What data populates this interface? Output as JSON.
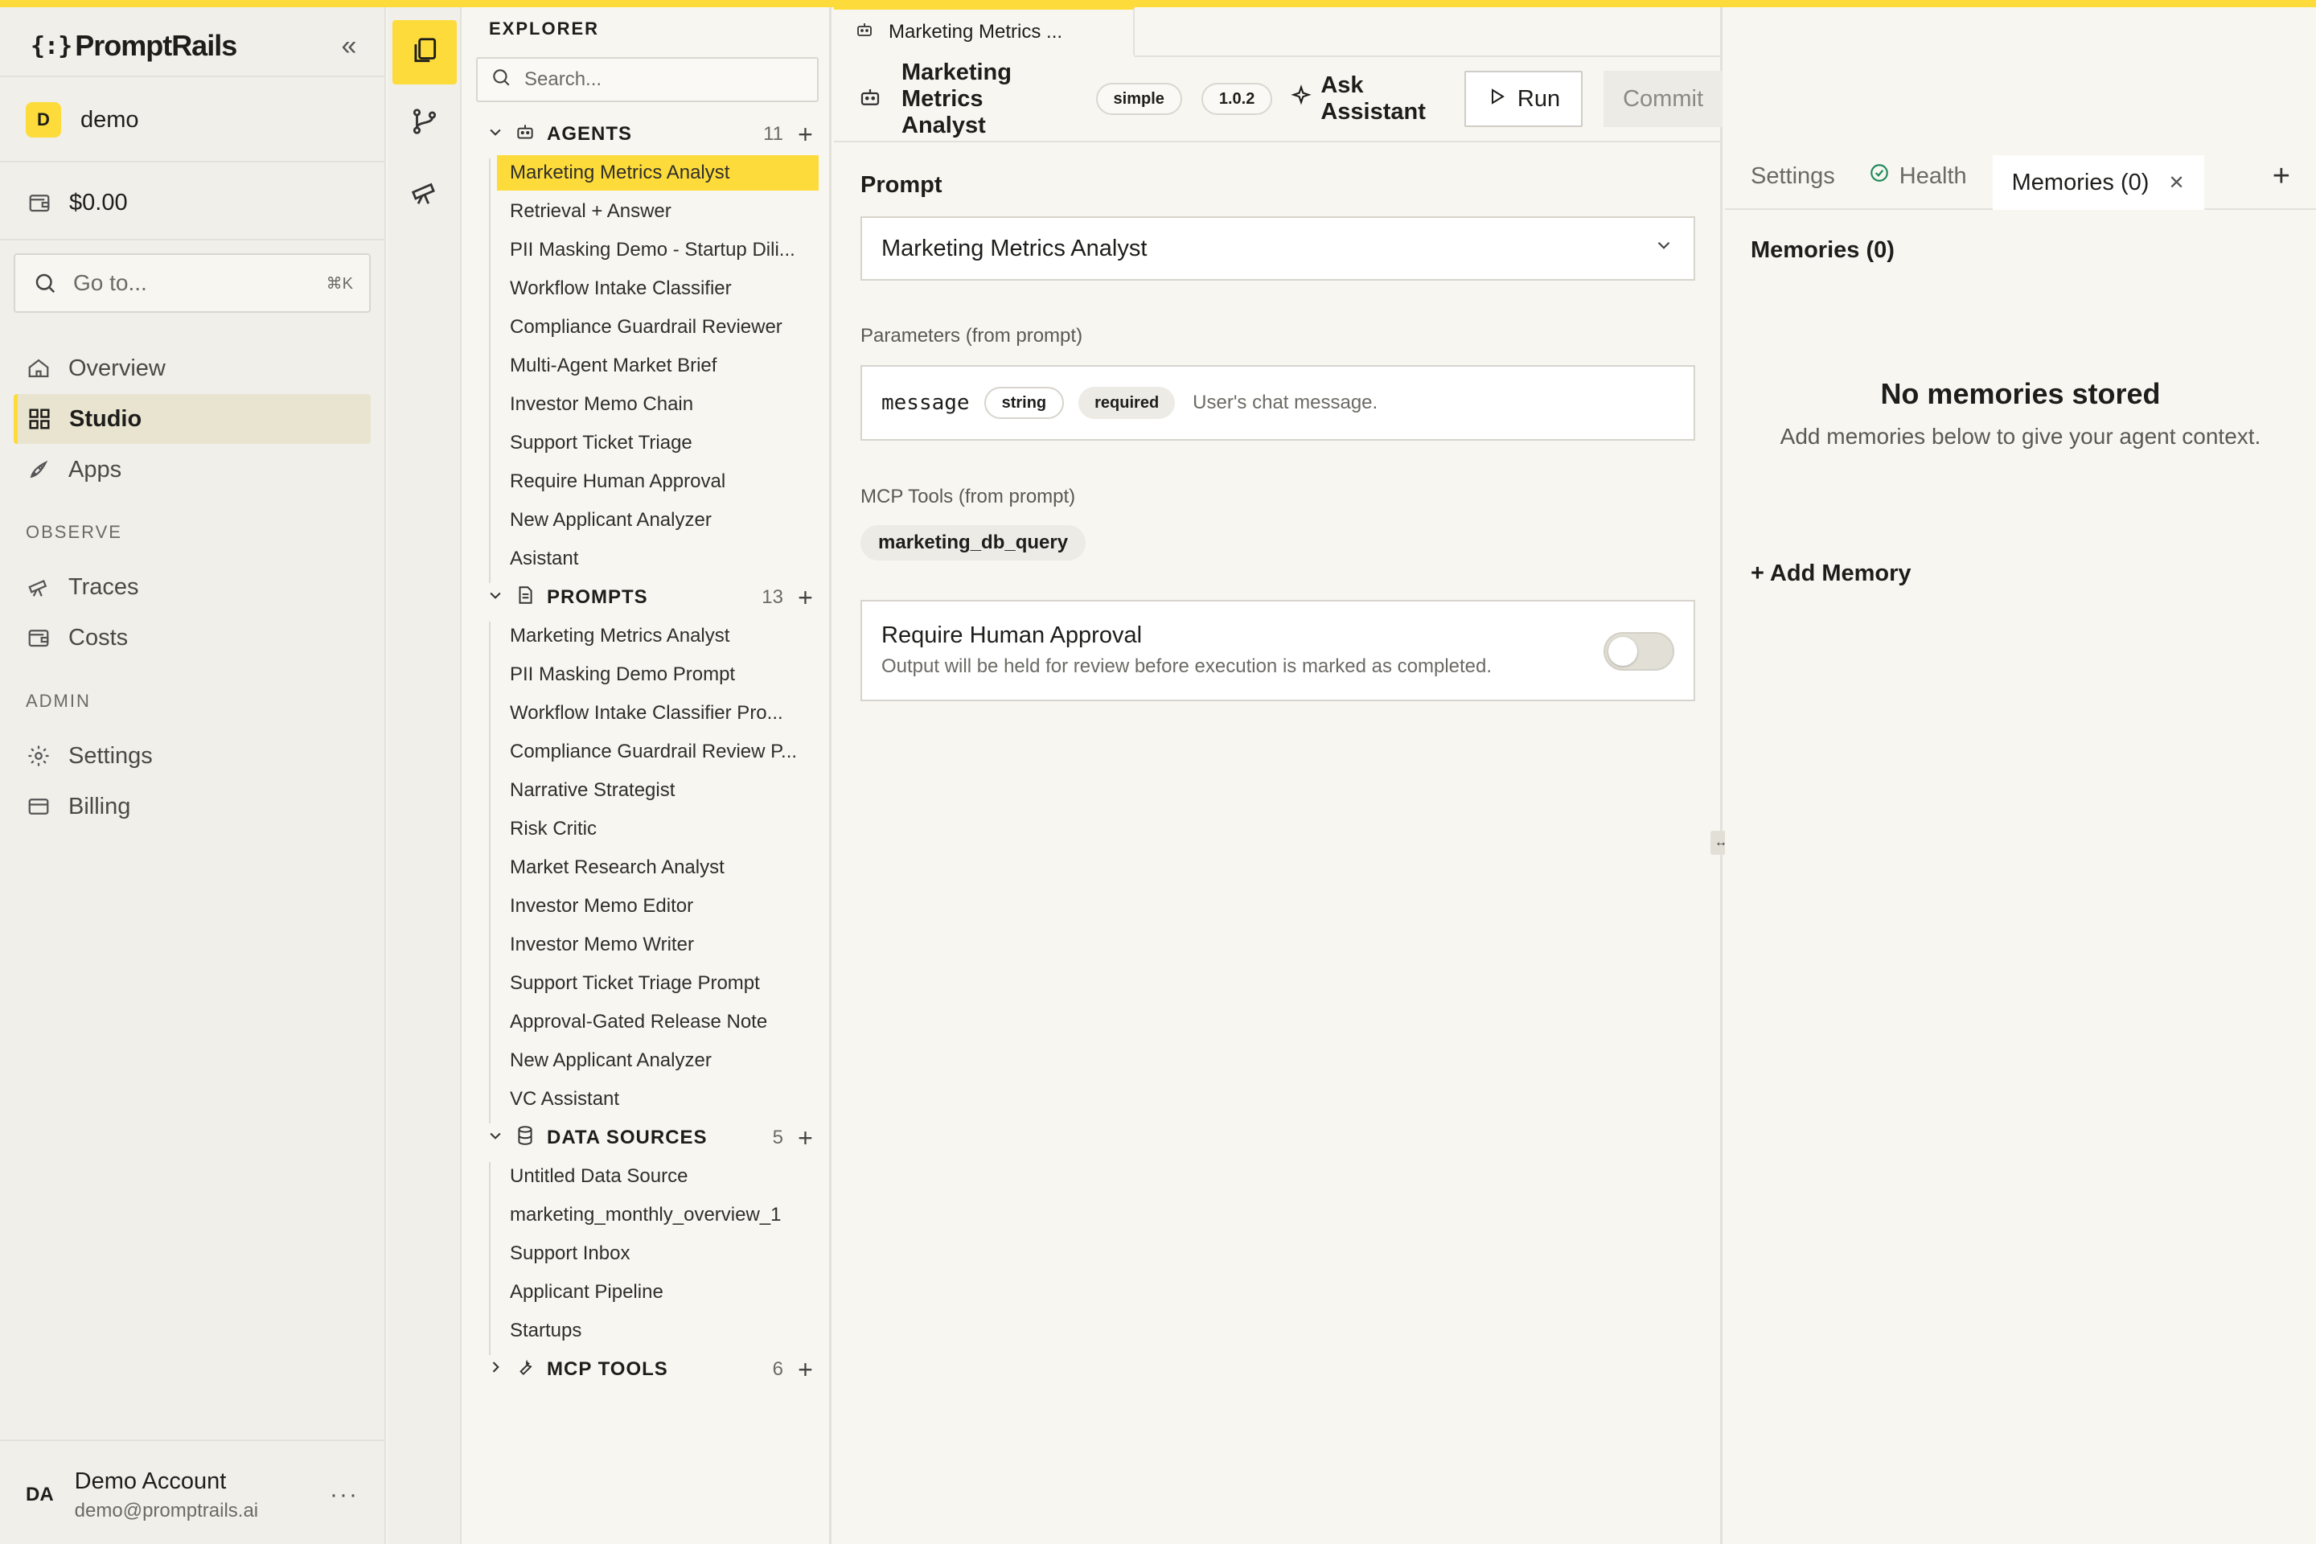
{
  "brand": {
    "name": "PromptRails",
    "accent": "#fddb3a"
  },
  "sidebar": {
    "collapse_label": "«",
    "workspace": {
      "initial": "D",
      "name": "demo"
    },
    "balance": "$0.00",
    "goto": {
      "placeholder": "Go to...",
      "shortcut": "⌘K"
    },
    "nav": [
      {
        "label": "Overview",
        "icon": "home-icon"
      },
      {
        "label": "Studio",
        "icon": "grid-icon",
        "active": true
      },
      {
        "label": "Apps",
        "icon": "rocket-icon"
      }
    ],
    "observe_label": "OBSERVE",
    "observe": [
      {
        "label": "Traces",
        "icon": "telescope-icon"
      },
      {
        "label": "Costs",
        "icon": "wallet-icon"
      }
    ],
    "admin_label": "ADMIN",
    "admin": [
      {
        "label": "Settings",
        "icon": "gear-icon"
      },
      {
        "label": "Billing",
        "icon": "card-icon"
      }
    ],
    "account": {
      "initials": "DA",
      "name": "Demo Account",
      "email": "demo@promptrails.ai",
      "more": "···"
    }
  },
  "explorer": {
    "title": "EXPLORER",
    "search_placeholder": "Search...",
    "agents": {
      "label": "AGENTS",
      "count": "11",
      "items": [
        "Marketing Metrics Analyst",
        "Retrieval + Answer",
        "PII Masking Demo - Startup Dili...",
        "Workflow Intake Classifier",
        "Compliance Guardrail Reviewer",
        "Multi-Agent Market Brief",
        "Investor Memo Chain",
        "Support Ticket Triage",
        "Require Human Approval",
        "New Applicant Analyzer",
        "Asistant"
      ]
    },
    "prompts": {
      "label": "PROMPTS",
      "count": "13",
      "items": [
        "Marketing Metrics Analyst",
        "PII Masking Demo Prompt",
        "Workflow Intake Classifier Pro...",
        "Compliance Guardrail Review P...",
        "Narrative Strategist",
        "Risk Critic",
        "Market Research Analyst",
        "Investor Memo Editor",
        "Investor Memo Writer",
        "Support Ticket Triage Prompt",
        "Approval-Gated Release Note",
        "New Applicant Analyzer",
        "VC Assistant"
      ]
    },
    "data_sources": {
      "label": "DATA SOURCES",
      "count": "5",
      "items": [
        "Untitled Data Source",
        "marketing_monthly_overview_1",
        "Support Inbox",
        "Applicant Pipeline",
        "Startups"
      ]
    },
    "mcp_tools": {
      "label": "MCP TOOLS",
      "count": "6"
    }
  },
  "editor": {
    "tab_label": "Marketing Metrics ...",
    "title": "Marketing Metrics Analyst",
    "type_badge": "simple",
    "version_badge": "1.0.2",
    "ask_label": "Ask Assistant",
    "run_label": "Run",
    "commit_label": "Commit",
    "prompt_label": "Prompt",
    "prompt_value": "Marketing Metrics Analyst",
    "params_label": "Parameters (from prompt)",
    "param": {
      "name": "message",
      "type": "string",
      "required": "required",
      "description": "User's chat message."
    },
    "tools_label": "MCP Tools (from prompt)",
    "tool": "marketing_db_query",
    "approval": {
      "title": "Require Human Approval",
      "description": "Output will be held for review before execution is marked as completed.",
      "enabled": false
    }
  },
  "panel": {
    "tabs": {
      "settings": "Settings",
      "health": "Health",
      "memories": "Memories (0)"
    },
    "memories_title": "Memories (0)",
    "empty_title": "No memories stored",
    "empty_sub": "Add memories below to give your agent context.",
    "add_label": "+ Add Memory"
  }
}
